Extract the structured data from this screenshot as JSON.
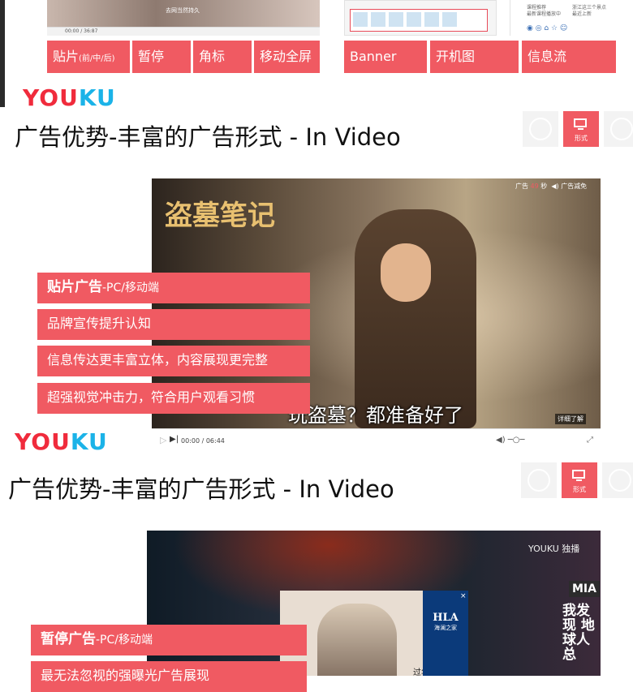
{
  "top": {
    "video_subtitle": "去网当然持久",
    "video_time": "00:00 / 36:87",
    "phone_texts": [
      "课程推荐",
      "浙江这三个景点",
      "最新课程播放中",
      "最近上新",
      "课程推荐"
    ],
    "buttons_left": [
      {
        "main": "贴片",
        "small": "(前/中/后)"
      },
      {
        "main": "暂停",
        "small": ""
      },
      {
        "main": "角标",
        "small": ""
      },
      {
        "main": "移动全屏",
        "small": ""
      }
    ],
    "buttons_right": [
      "Banner",
      "开机图",
      "信息流"
    ]
  },
  "logo": {
    "part1": "YOU",
    "part2": "KU"
  },
  "section1": {
    "title": "广告优势-丰富的广告形式 - In Video",
    "icon_label": "形式",
    "video": {
      "show_title": "盗墓笔记",
      "ad_tag_prefix": "广告",
      "ad_seconds": "49",
      "ad_tag_suffix": "秒",
      "ad_remove": "广告减免",
      "subtitle": "玩盗墓？都准备好了",
      "more_label": "详细了解",
      "time": "00:00 / 06:44"
    },
    "overlay": {
      "heading_bold": "贴片广告",
      "heading_rest": "-PC/移动端",
      "items": [
        "品牌宣传提升认知",
        "信息传达更丰富立体，内容展现更完整",
        "超强视觉冲击力，符合用户观看习惯"
      ]
    }
  },
  "section2": {
    "title": "广告优势-丰富的广告形式 - In Video",
    "icon_label": "形式",
    "video": {
      "brand": "YOUKU 独播",
      "popup_brand": "HLA",
      "popup_brand_cn": "海澜之家",
      "popup_caption": "过年回家",
      "close": "×",
      "show_badge": "MIA",
      "side_text": "我发现 地球人总"
    },
    "overlay": {
      "heading_bold": "暂停广告",
      "heading_rest": "-PC/移动端",
      "items": [
        "最无法忽视的强曝光广告展现"
      ]
    }
  },
  "colors": {
    "accent": "#f05a62",
    "logo_red": "#f02b3c",
    "logo_blue": "#1bb3e8"
  }
}
